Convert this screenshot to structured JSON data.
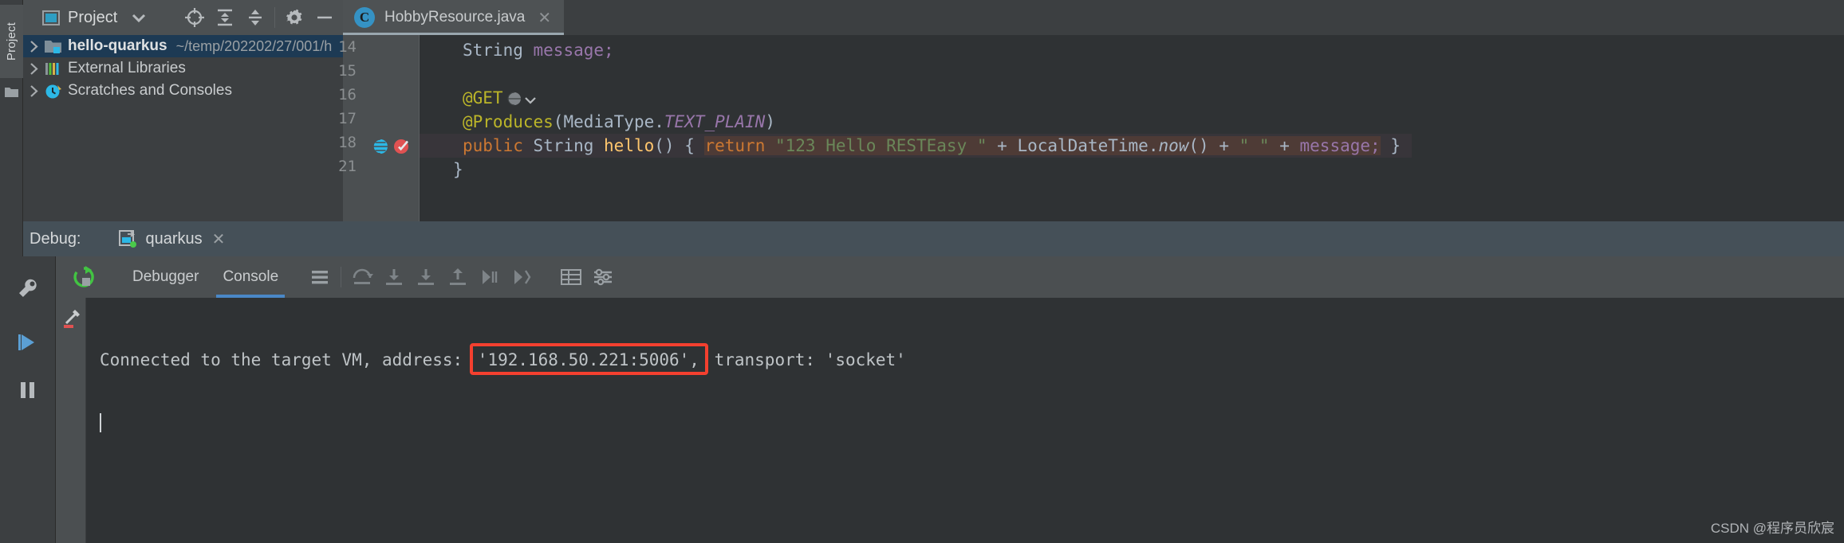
{
  "left_toolbar": {
    "project_tab": "Project",
    "folder_icon": "folder-icon"
  },
  "project_panel": {
    "title": "Project",
    "title_icon": "project-view-icon",
    "caret_icon": "chevron-down-icon",
    "actions": [
      {
        "name": "locate-icon",
        "tooltip": "Select Opened File"
      },
      {
        "name": "collapse-all-icon",
        "tooltip": "Collapse All"
      },
      {
        "name": "expand-collapse-icon",
        "tooltip": "Expand All"
      },
      {
        "name": "gear-icon",
        "tooltip": "Settings"
      },
      {
        "name": "hide-icon",
        "tooltip": "Hide"
      }
    ],
    "tree": [
      {
        "arrow": "chevron-right-icon",
        "icon": "module-icon",
        "label": "hello-quarkus",
        "path": "~/temp/202202/27/001/h",
        "selected": true
      },
      {
        "arrow": "chevron-right-icon",
        "icon": "library-icon",
        "label": "External Libraries",
        "path": "",
        "selected": false
      },
      {
        "arrow": "chevron-right-icon",
        "icon": "scratches-icon",
        "label": "Scratches and Consoles",
        "path": "",
        "selected": false
      }
    ]
  },
  "editor": {
    "tab": {
      "icon_letter": "C",
      "icon_name": "java-class-icon",
      "filename": "HobbyResource.java",
      "close_icon": "close-icon"
    },
    "lines": [
      {
        "number": "14",
        "text": "String message;"
      },
      {
        "number": "15",
        "text": ""
      },
      {
        "number": "16",
        "text": "@GET"
      },
      {
        "number": "17",
        "text": "@Produces(MediaType.TEXT_PLAIN)"
      },
      {
        "number": "18",
        "text": "public String hello() { return \"123 Hello RESTEasy \" + LocalDateTime.now() + \" \" + message; }"
      },
      {
        "number": "21",
        "text": "}"
      }
    ],
    "line18_gutter_icons": [
      "endpoint-globe-icon",
      "breakpoint-verified-icon"
    ],
    "code_tokens": {
      "l14_type": "String",
      "l14_field": "message;",
      "l16_annotation": "@GET",
      "l16_gutter_inline": "globe-icon",
      "l16_caret": "chevron-down-icon",
      "l17_annotation": "@Produces",
      "l17_open": "(",
      "l17_mediatype": "MediaType.",
      "l17_const": "TEXT_PLAIN",
      "l17_close": ")",
      "l18_kw": "public",
      "l18_type": "String",
      "l18_fn": "hello",
      "l18_parens": "()",
      "l18_brace": " { ",
      "l18_return": "return",
      "l18_str1": "\"123 Hello RESTEasy \"",
      "l18_plus1": " + ",
      "l18_ldt": "LocalDateTime.",
      "l18_now": "now",
      "l18_now_parens": "()",
      "l18_plus2": " + ",
      "l18_str2": "\" \"",
      "l18_plus3": " + ",
      "l18_field": "message;",
      "l18_endbrace": " }",
      "l21_brace": "}"
    }
  },
  "debug": {
    "title": "Debug:",
    "run_config_icon": "run-config-icon",
    "run_config_name": "quarkus",
    "close_icon": "close-icon",
    "sidebar_icons": [
      "wrench-icon",
      "resume-icon",
      "pause-icon"
    ],
    "toolbar": {
      "rerun_icon": "rerun-icon",
      "tabs": [
        {
          "label": "Debugger",
          "active": false
        },
        {
          "label": "Console",
          "active": true
        }
      ],
      "icons": [
        "layout-icon",
        "step-over-icon",
        "step-into-icon",
        "force-step-into-icon",
        "step-out-icon",
        "run-to-cursor-icon",
        "evaluate-icon",
        "table-icon",
        "settings-icon"
      ]
    },
    "console_gutter_icons": [
      "soft-wrap-icon",
      "clear-all-icon"
    ],
    "console": {
      "line1_prefix": "Connected to the target VM, address: ",
      "line1_address": "'192.168.50.221:5006',",
      "line1_suffix": " transport: 'socket'",
      "highlight_color": "#f4402f"
    }
  },
  "watermark": "CSDN @程序员欣宸"
}
